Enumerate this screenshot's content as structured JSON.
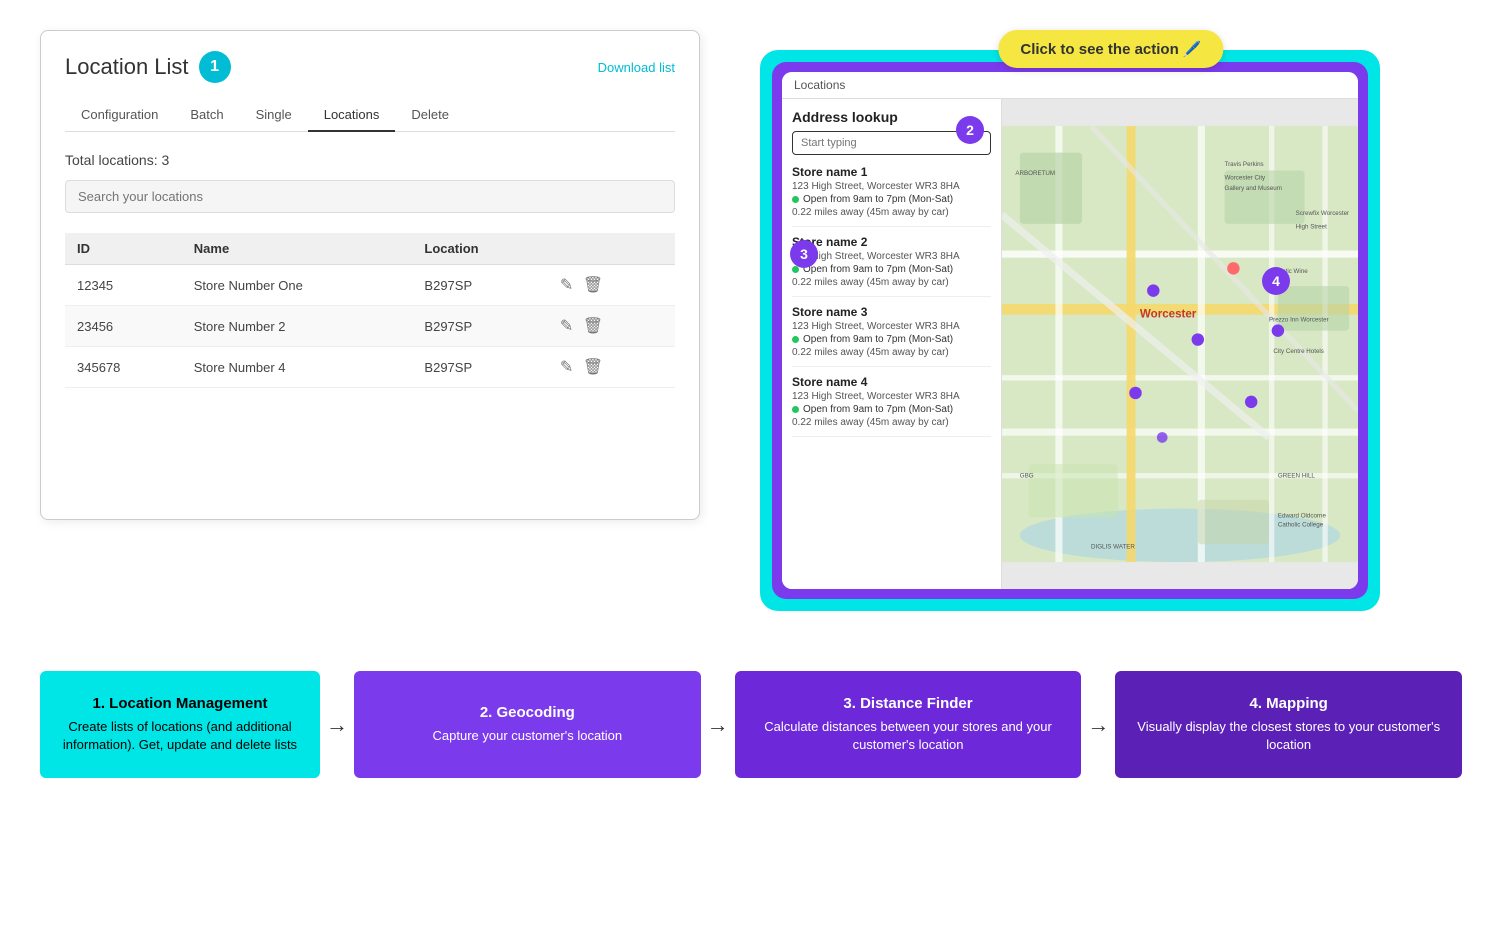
{
  "header": {
    "click_badge": "Click to see the action 🖊️"
  },
  "location_list_panel": {
    "title": "Location List",
    "badge_number": "1",
    "download_link": "Download list",
    "nav_tabs": [
      {
        "label": "Configuration",
        "active": false
      },
      {
        "label": "Batch",
        "active": false
      },
      {
        "label": "Single",
        "active": false
      },
      {
        "label": "Locations",
        "active": true
      },
      {
        "label": "Delete",
        "active": false
      }
    ],
    "total_locations": "Total locations: 3",
    "search_placeholder": "Search your locations",
    "table": {
      "headers": [
        "ID",
        "Name",
        "Location",
        ""
      ],
      "rows": [
        {
          "id": "12345",
          "name": "Store Number One",
          "location": "B297SP"
        },
        {
          "id": "23456",
          "name": "Store Number 2",
          "location": "B297SP"
        },
        {
          "id": "345678",
          "name": "Store Number 4",
          "location": "B297SP"
        }
      ]
    }
  },
  "app_demo": {
    "app_header_label": "Locations",
    "address_lookup_title": "Address lookup",
    "address_placeholder": "Start typing",
    "badge_2": "2",
    "badge_3": "3",
    "badge_4": "4",
    "stores": [
      {
        "name": "Store name 1",
        "address": "123 High Street, Worcester WR3 8HA",
        "hours": "Open from 9am to 7pm (Mon-Sat)",
        "distance": "0.22 miles away (45m away by car)"
      },
      {
        "name": "Store name 2",
        "address": "123 High Street, Worcester WR3 8HA",
        "hours": "Open from 9am to 7pm (Mon-Sat)",
        "distance": "0.22 miles away (45m away by car)"
      },
      {
        "name": "Store name 3",
        "address": "123 High Street, Worcester WR3 8HA",
        "hours": "Open from 9am to 7pm (Mon-Sat)",
        "distance": "0.22 miles away (45m away by car)"
      },
      {
        "name": "Store name 4",
        "address": "123 High Street, Worcester WR3 8HA",
        "hours": "Open from 9am to 7pm (Mon-Sat)",
        "distance": "0.22 miles away (45m away by car)"
      }
    ],
    "map_label": "Worcester"
  },
  "flow": {
    "boxes": [
      {
        "id": "box1",
        "style": "cyan",
        "title": "1. Location Management",
        "body": "Create lists of locations (and additional information). Get, update and delete lists"
      },
      {
        "id": "box2",
        "style": "purple-light",
        "title": "2. Geocoding",
        "body": "Capture your customer's location"
      },
      {
        "id": "box3",
        "style": "purple-mid",
        "title": "3. Distance Finder",
        "body": "Calculate distances between your stores and your customer's location"
      },
      {
        "id": "box4",
        "style": "purple-dark",
        "title": "4. Mapping",
        "body": "Visually display the closest stores to your customer's location"
      }
    ],
    "arrow": "→"
  }
}
